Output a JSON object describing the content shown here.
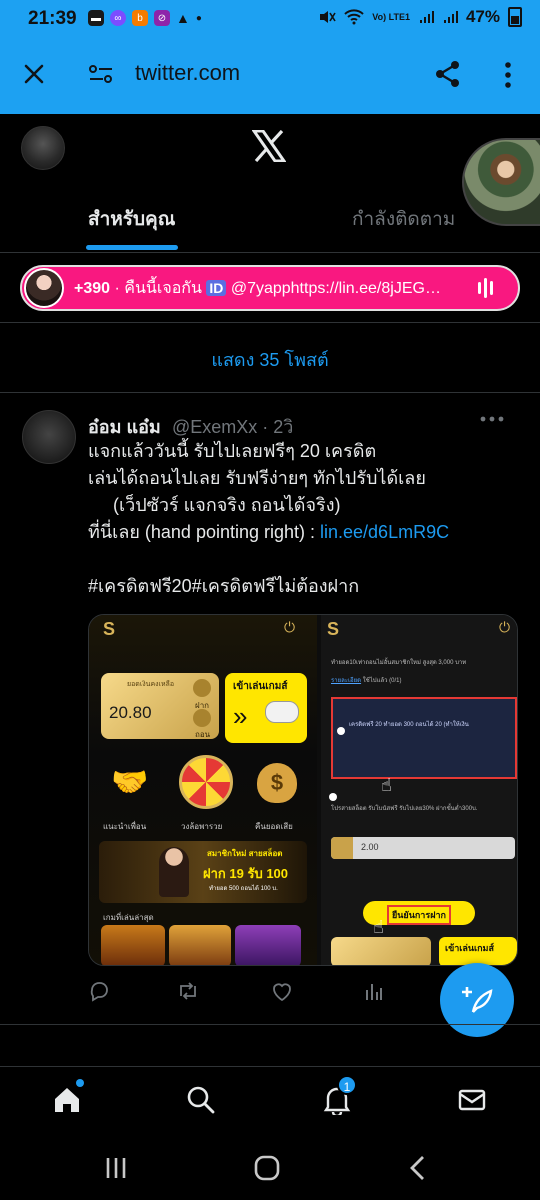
{
  "status_bar": {
    "time": "21:39",
    "network": "Vo) LTE1",
    "battery": "47%"
  },
  "browser": {
    "url": "twitter.com",
    "icons": [
      "close-icon",
      "site-settings-icon",
      "share-icon",
      "more-vert-icon"
    ]
  },
  "header": {
    "tabs": [
      {
        "label": "สำหรับคุณ",
        "active": true
      },
      {
        "label": "กำลังติดตาม",
        "active": false
      }
    ]
  },
  "live_banner": {
    "count": "+390",
    "text": " · คืนนี้เจอกัน ",
    "id_badge": "ID",
    "rest": " @7yapphttps://lin.ee/8jJEG…"
  },
  "show_more": "แสดง 35 โพสต์",
  "tweet": {
    "name": "อ๋อม แอ๋ม",
    "handle": "@ExemXx · 2วิ",
    "lines": [
      "แจกแล้ววันนี้ รับไปเลยฟรีๆ 20 เครดิต",
      "เล่นได้ถอนไปเลย รับฟรีง่ายๆ ทักไปรับได้เลย",
      "     (เว็ปซัวร์ แจกจริง ถอนได้จริง)"
    ],
    "link_prefix": "ที่นี่เลย (hand pointing right) : ",
    "link": "lin.ee/d6LmR9C",
    "hashtags": "#เครดิตฟรี20#เครดิตฟรีไม่ต้องฝาก",
    "media": {
      "left": {
        "balance_label": "ยอดเงินคงเหลือ",
        "balance": "20.80",
        "deposit": "ฝาก",
        "withdraw": "ถอน",
        "play_button": "เข้าเล่นเกมส์",
        "menu": [
          "แนะนำเพื่อน",
          "วงล้อพารวย",
          "คืนยอดเสีย"
        ],
        "promo_title": "สมาชิกใหม่ สายสล็อต",
        "promo_main": "ฝาก 19 รับ 100",
        "promo_sub": "ทำยอด 500 ถอนได้ 100 บ.",
        "recent_games": "เกมที่เล่นล่าสุด"
      },
      "right": {
        "text1": "ทำยอด10เท่าถอนไม่อั้นสมาชิกใหม่ สูงสุด 3,000 บาท",
        "detail_link": "รายละเอียด",
        "quota1": "ใช้ไปแล้ว (0/1)",
        "text2": "เครดิตฟรี 20 ทำยอด 300 ถอนได้ 20 (ทำให้เงิน",
        "text3": "โปรสายสล็อต รับโบนัสฟรี รับไปเลย30% ฝากขั้นต่ำ300บ.",
        "amount": "2.00",
        "confirm_button": "ยืนยันการฝาก",
        "play_button": "เข้าเล่นเกมส์"
      }
    }
  },
  "bottom_nav": {
    "notifications_badge": "1"
  }
}
